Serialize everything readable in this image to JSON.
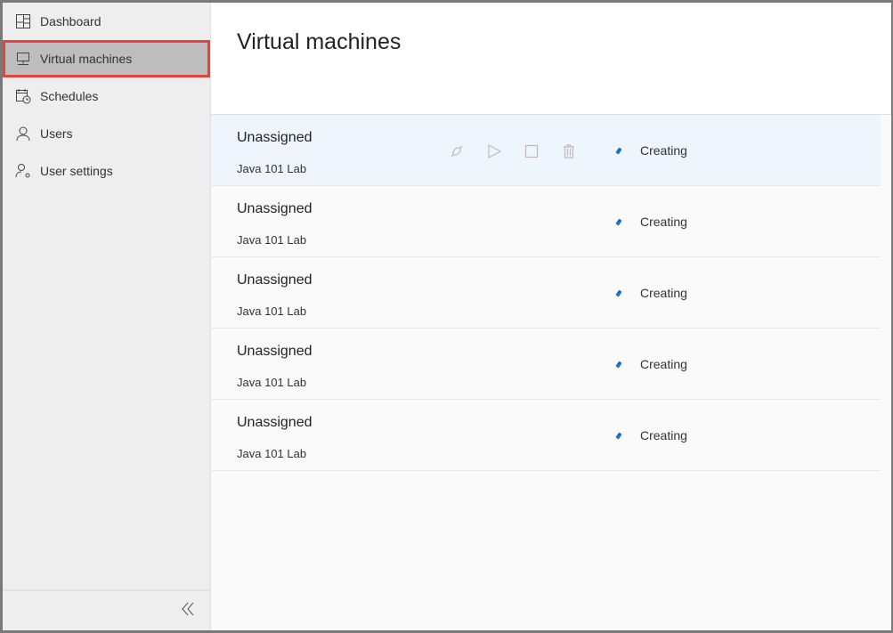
{
  "sidebar": {
    "items": [
      {
        "label": "Dashboard",
        "icon": "dashboard-icon"
      },
      {
        "label": "Virtual machines",
        "icon": "monitor-icon",
        "active": true
      },
      {
        "label": "Schedules",
        "icon": "calendar-clock-icon"
      },
      {
        "label": "Users",
        "icon": "user-icon"
      },
      {
        "label": "User settings",
        "icon": "user-settings-icon"
      }
    ],
    "collapse_icon": "double-chevron-left-icon"
  },
  "header": {
    "title": "Virtual machines"
  },
  "vms": [
    {
      "name": "Unassigned",
      "lab": "Java 101 Lab",
      "status": "Creating"
    },
    {
      "name": "Unassigned",
      "lab": "Java 101 Lab",
      "status": "Creating"
    },
    {
      "name": "Unassigned",
      "lab": "Java 101 Lab",
      "status": "Creating"
    },
    {
      "name": "Unassigned",
      "lab": "Java 101 Lab",
      "status": "Creating"
    },
    {
      "name": "Unassigned",
      "lab": "Java 101 Lab",
      "status": "Creating"
    }
  ],
  "colors": {
    "accent": "#1a73c8",
    "highlight": "#e8433b"
  }
}
